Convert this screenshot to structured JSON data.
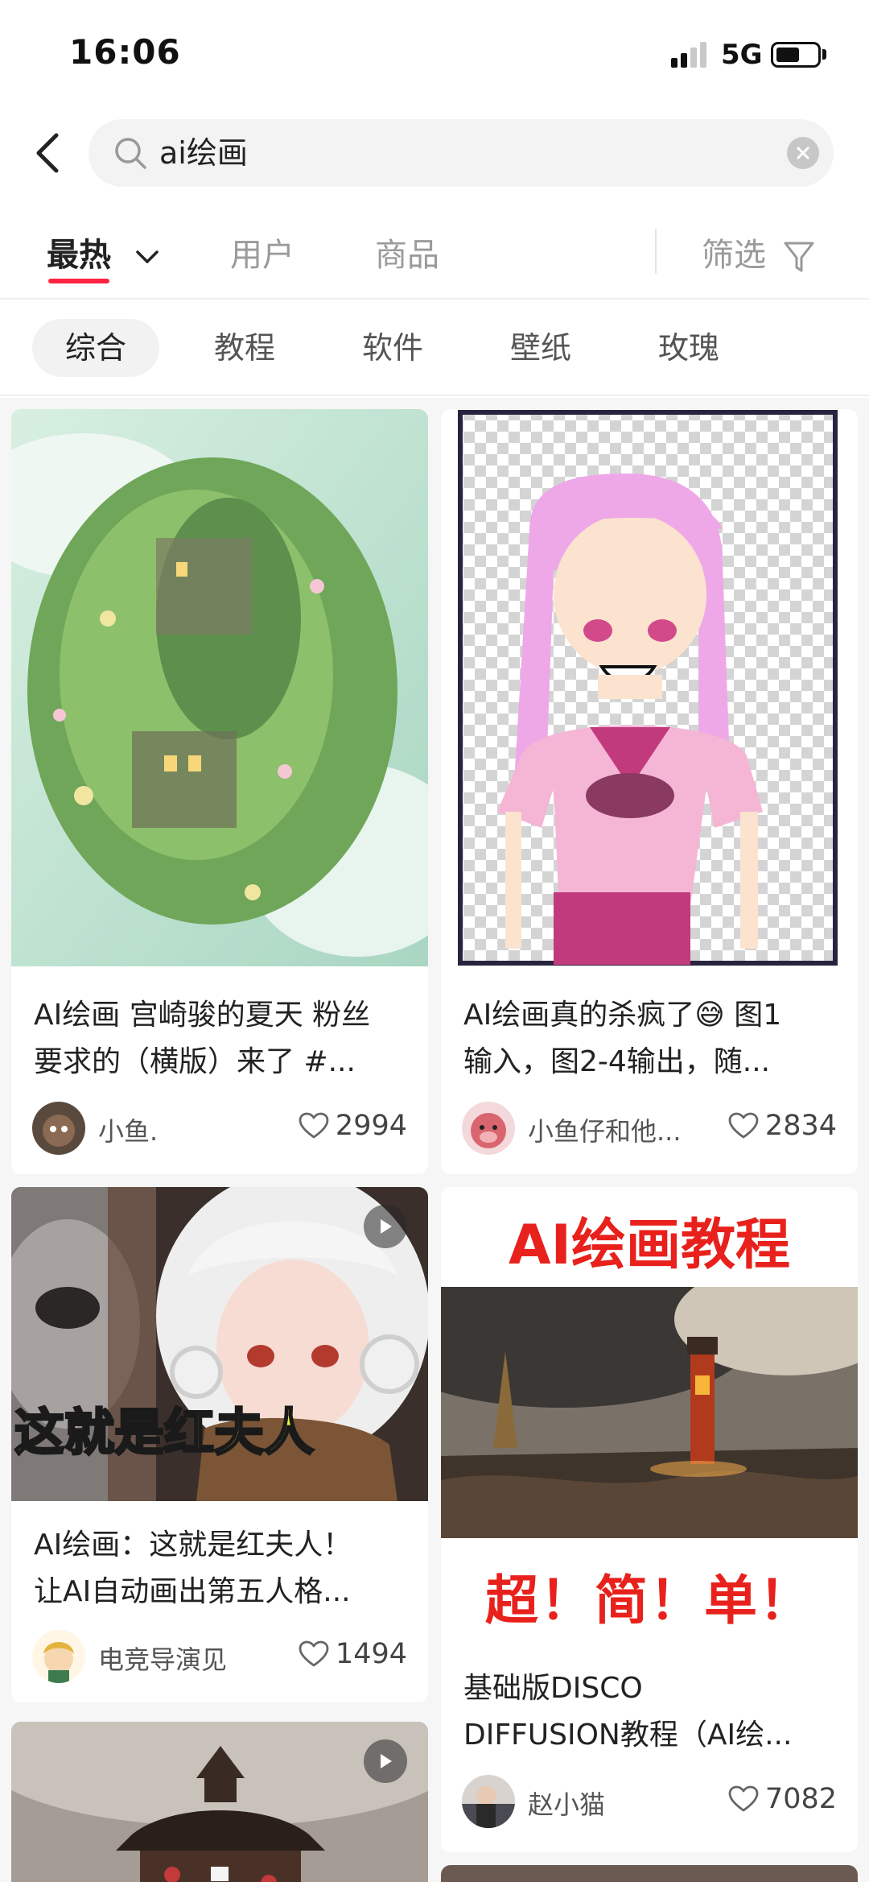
{
  "status_bar": {
    "time": "16:06",
    "network": "5G",
    "icons": [
      "signal-icon",
      "battery-icon"
    ]
  },
  "search": {
    "query": "ai绘画",
    "icons": [
      "back-icon",
      "search-icon",
      "clear-icon"
    ]
  },
  "tabs": {
    "items": [
      "最热",
      "用户",
      "商品"
    ],
    "active": "最热",
    "filter_label": "筛选",
    "icons": [
      "chevron-down-icon",
      "filter-icon"
    ]
  },
  "chips": {
    "items": [
      "综合",
      "教程",
      "软件",
      "壁纸",
      "玫瑰"
    ],
    "active": "综合"
  },
  "cards": [
    {
      "title_line1": "AI绘画 宫崎骏的夏天 粉丝",
      "title_line2": "要求的（横版）来了 #...",
      "author": "小鱼.",
      "likes": "2994",
      "image": "ghibli-landscape"
    },
    {
      "title_line1": "AI绘画真的杀疯了😅 图1",
      "title_line2": "输入，图2-4输出，随...",
      "author": "小鱼仔和他...",
      "likes": "2834",
      "image": "pink-hair-sketch"
    },
    {
      "overlay_text": "这就是红夫人",
      "title_line1": "AI绘画：这就是红夫人！",
      "title_line2": "让AI自动画出第五人格...",
      "author": "电竞导演见",
      "likes": "1494",
      "image": "anime-girl-video"
    },
    {
      "banner_top": "AI绘画教程",
      "banner_bottom": "超！简！单！",
      "title_line1": "基础版DISCO",
      "title_line2": "DIFFUSION教程（AI绘...",
      "author": "赵小猫",
      "likes": "7082",
      "image": "lighthouse-painting"
    }
  ],
  "colors": {
    "accent": "#ff2442",
    "banner_red": "#e8211c",
    "overlay_yellow": "#e8f53a"
  }
}
